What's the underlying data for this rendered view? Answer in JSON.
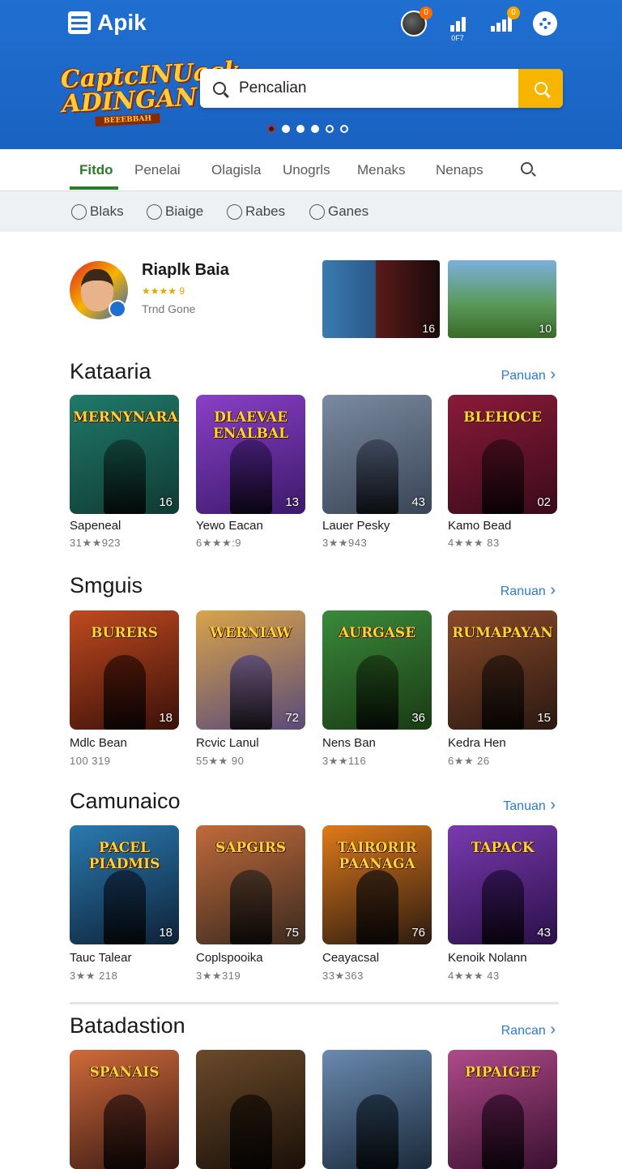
{
  "header": {
    "app_name": "Apik",
    "brand_logo_title": "CaptcINUack ADINGAN",
    "brand_logo_sub": "BEEEBBAH",
    "notification_count": "0",
    "signal_badge_count": "0",
    "wifi_label": "0F7"
  },
  "search": {
    "placeholder": "Pencalian"
  },
  "carousel": {
    "dot_count": 6,
    "active_index": 0
  },
  "tabs": [
    {
      "label": "Fitdo",
      "active": true
    },
    {
      "label": "Penelai"
    },
    {
      "label": "Olagisla"
    },
    {
      "label": "Unogrls"
    },
    {
      "label": "Menaks"
    },
    {
      "label": "Nenaps"
    }
  ],
  "filters": [
    "Blaks",
    "Biaige",
    "Rabes",
    "Ganes"
  ],
  "featured": {
    "title": "Riaplk Baia",
    "stars": "★★★★ 9",
    "subtitle": "Trnd Gone",
    "screenshots": [
      {
        "label": "16"
      },
      {
        "label": "10"
      }
    ]
  },
  "sections": [
    {
      "title": "Kataaria",
      "link": "Panuan",
      "cards": [
        {
          "art_title": "MERNYNARAN",
          "num": "16",
          "name": "Sapeneal",
          "rating": "31★★923",
          "color_a": "#1f7a6a",
          "color_b": "#103a33"
        },
        {
          "art_title": "DLAEVAE ENALBAL",
          "num": "13",
          "name": "Yewo Eacan",
          "rating": "6★★★:9",
          "color_a": "#8a3fc7",
          "color_b": "#3b1a6a"
        },
        {
          "art_title": "",
          "num": "43",
          "name": "Lauer Pesky",
          "rating": "3★★943",
          "color_a": "#7a8aa0",
          "color_b": "#3a4456"
        },
        {
          "art_title": "BLEHOCE",
          "num": "02",
          "name": "Kamo Bead",
          "rating": "4★★★ 83",
          "color_a": "#8a1a3a",
          "color_b": "#3a0b1a"
        }
      ]
    },
    {
      "title": "Smguis",
      "link": "Ranuan",
      "cards": [
        {
          "art_title": "BURERS",
          "num": "18",
          "name": "Mdlc Bean",
          "rating": "100 319",
          "color_a": "#c04a20",
          "color_b": "#3a1008"
        },
        {
          "art_title": "WERNIAW",
          "num": "72",
          "name": "Rcvic Lanul",
          "rating": "55★★ 90",
          "color_a": "#d9a44a",
          "color_b": "#5a4a7a"
        },
        {
          "art_title": "AURGASE",
          "num": "36",
          "name": "Nens Ban",
          "rating": "3★★116",
          "color_a": "#3a8a3a",
          "color_b": "#1a3a14"
        },
        {
          "art_title": "RUMAPAYAN",
          "num": "15",
          "name": "Kedra Hen",
          "rating": "6★★ 26",
          "color_a": "#8a4a2a",
          "color_b": "#2a1810"
        }
      ]
    },
    {
      "title": "Camunaico",
      "link": "Tanuan",
      "cards": [
        {
          "art_title": "PACEL PIADMIS",
          "num": "18",
          "name": "Tauc Talear",
          "rating": "3★★ 218",
          "color_a": "#2a7ab0",
          "color_b": "#0e2238"
        },
        {
          "art_title": "SAPGIRS",
          "num": "75",
          "name": "Coplspooika",
          "rating": "3★★319",
          "color_a": "#c06a3a",
          "color_b": "#3a2a20"
        },
        {
          "art_title": "TAIRORIR PAANAGA",
          "num": "76",
          "name": "Ceayacsal",
          "rating": "33★363",
          "color_a": "#e07a1a",
          "color_b": "#2a1a10"
        },
        {
          "art_title": "TAPACK",
          "num": "43",
          "name": "Kenoik Nolann",
          "rating": "4★★★ 43",
          "color_a": "#7a3ab0",
          "color_b": "#2a1048"
        }
      ]
    },
    {
      "title": "Batadastion",
      "link": "Rancan",
      "cards": [
        {
          "art_title": "SPANAIS",
          "color_a": "#d06a3a",
          "color_b": "#3a1a14"
        },
        {
          "art_title": "",
          "color_a": "#6a4a2a",
          "color_b": "#1a1008"
        },
        {
          "art_title": "",
          "color_a": "#6a8ab0",
          "color_b": "#1a2a3a"
        },
        {
          "art_title": "PIPAIGEF",
          "color_a": "#b04a8a",
          "color_b": "#3a1030"
        }
      ]
    }
  ]
}
